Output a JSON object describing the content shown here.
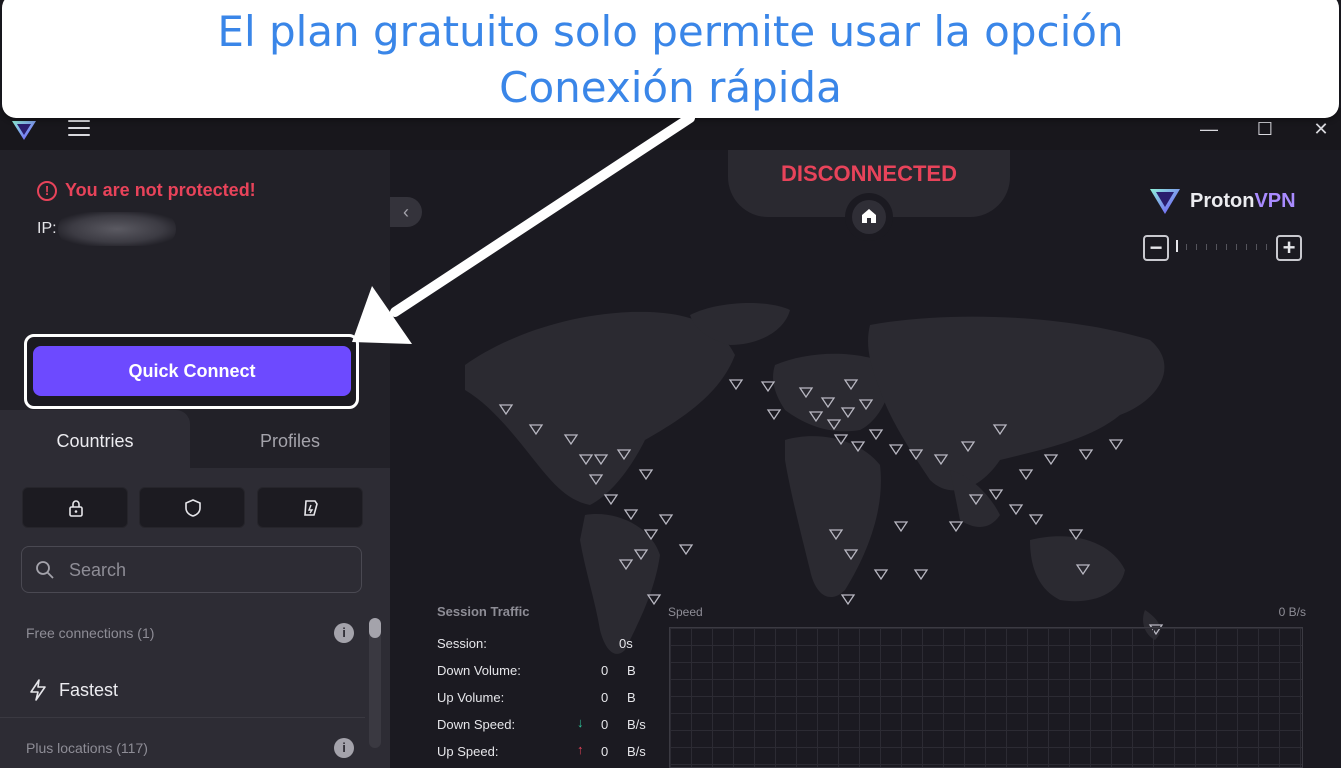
{
  "annotation": {
    "line1": "El plan gratuito solo permite usar la opción",
    "line2": "Conexión rápida"
  },
  "window": {
    "controls": [
      "minimize",
      "maximize",
      "close"
    ]
  },
  "sidebar": {
    "warning": "You are not protected!",
    "ip_label": "IP:",
    "quick_connect": "Quick Connect",
    "tabs": [
      {
        "label": "Countries",
        "active": true
      },
      {
        "label": "Profiles",
        "active": false
      }
    ],
    "filters": [
      "lock-icon",
      "shield-icon",
      "tor-icon"
    ],
    "search": {
      "placeholder": "Search",
      "value": ""
    },
    "sections": [
      {
        "label": "Free connections (1)"
      },
      {
        "label": "Plus locations (117)"
      }
    ],
    "fastest": "Fastest"
  },
  "map": {
    "status": "DISCONNECTED",
    "brand_prefix": "Proton",
    "brand_suffix": "VPN",
    "zoom_out": "−",
    "zoom_in": "+"
  },
  "traffic": {
    "title": "Session Traffic",
    "rows": [
      {
        "label": "Session:",
        "value": "0s",
        "unit": ""
      },
      {
        "label": "Down Volume:",
        "value": "0",
        "unit": "B"
      },
      {
        "label": "Up Volume:",
        "value": "0",
        "unit": "B"
      },
      {
        "label": "Down Speed:",
        "value": "0",
        "unit": "B/s"
      },
      {
        "label": "Up Speed:",
        "value": "0",
        "unit": "B/s"
      }
    ],
    "speed_label": "Speed",
    "speed_value": "0  B/s"
  },
  "colors": {
    "accent": "#6d4aff",
    "danger": "#e8435a",
    "annotation_text": "#3a86e8"
  }
}
